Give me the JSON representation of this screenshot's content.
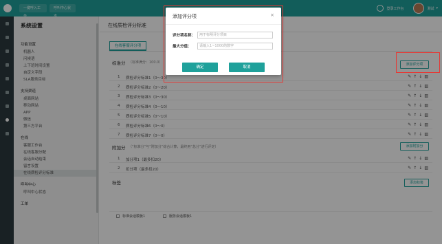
{
  "topbar": {
    "tabs": [
      "一键呼入工单",
      "呼叫中心状态"
    ],
    "status": "登录工作台",
    "user": "测试"
  },
  "sidebar": {
    "title": "系统设置",
    "groups": [
      {
        "label": "功能设置",
        "items": [
          "机器人",
          "问候语",
          "上下班时间设置",
          "自定义字段",
          "SLA服务目标"
        ]
      },
      {
        "label": "支持渠道",
        "items": [
          "桌面网站",
          "移动网站",
          "APP",
          "微信",
          "第三方平台"
        ]
      },
      {
        "label": "在线",
        "items": [
          "客服工作台",
          "在线客服分配",
          "会话自动结束",
          "留言设置",
          "在线质检评分标准"
        ]
      },
      {
        "label": "呼叫中心",
        "items": [
          "呼叫中心状态"
        ]
      },
      {
        "label": "工单",
        "items": []
      }
    ]
  },
  "main": {
    "page_title": "在线质检评分标准",
    "tab_label": "在线客服评分项",
    "standard": {
      "label": "标准分",
      "hint": "（标准满分：100.0）",
      "add_button": "添加评分项",
      "rows": [
        {
          "num": "1",
          "text": "质检评分标准1（0～30）"
        },
        {
          "num": "2",
          "text": "质检评分标准2（0～20）"
        },
        {
          "num": "3",
          "text": "质检评分标准3（0～30）"
        },
        {
          "num": "4",
          "text": "质检评分标准4（0～10）"
        },
        {
          "num": "5",
          "text": "质检评分标准5（0～10）"
        },
        {
          "num": "6",
          "text": "质检评分标准6（0～0）"
        },
        {
          "num": "7",
          "text": "质检评分标准7（0～0）"
        }
      ]
    },
    "extra": {
      "label": "附加分",
      "hint": "（“标准分”与“附加分”综合计算，最终用“总分”进行评定）",
      "add_button": "添加附加分",
      "rows": [
        {
          "num": "1",
          "text": "加分项1（最多扣20）"
        },
        {
          "num": "2",
          "text": "扣分项（最多扣20）"
        }
      ]
    },
    "tags": {
      "label": "标签",
      "add_button": "添加标签"
    },
    "footer": [
      "标准会话模板1",
      "服务会话模板1"
    ]
  },
  "modal": {
    "title": "添加评分项",
    "close": "×",
    "fields": [
      {
        "label": "评分项名称：",
        "placeholder": "用于标明评分项目"
      },
      {
        "label": "最大分值：",
        "placeholder": "请输入1~1000的数字"
      }
    ],
    "confirm": "确定",
    "cancel": "取消"
  },
  "colors": {
    "accent": "#1fa19b",
    "highlight": "#e53935"
  }
}
